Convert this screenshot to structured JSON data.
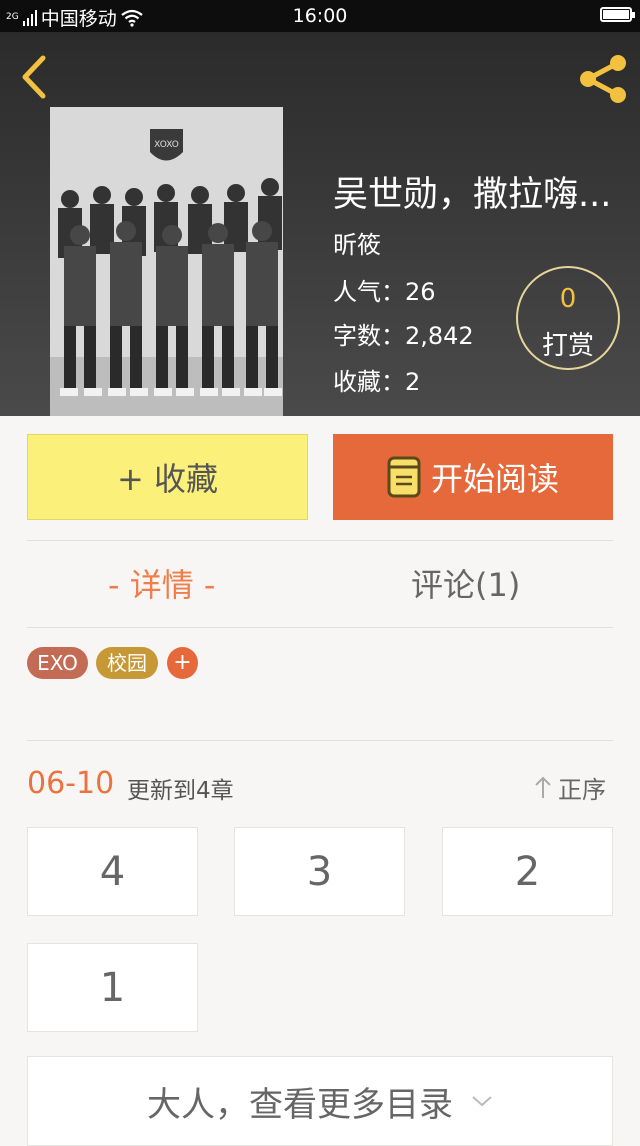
{
  "status_bar": {
    "signal_label": "2G",
    "carrier": "中国移动",
    "time": "16:00",
    "icons": [
      "signal-icon",
      "wifi-icon",
      "battery-icon"
    ]
  },
  "header": {
    "back_icon": "chevron-left-icon",
    "share_icon": "share-icon",
    "accent_color": "#f2c13f"
  },
  "book": {
    "title": "吴世勋，撒拉嗨...",
    "author": "昕筱",
    "popularity": "人气：26",
    "word_count": "字数：2,842",
    "favorites": "收藏：2",
    "reward_count": "0",
    "reward_label": "打赏",
    "cover_logo": "XOXO"
  },
  "actions": {
    "favorite_label": "+ 收藏",
    "read_label": "开始阅读",
    "read_icon": "book-icon"
  },
  "tabs": {
    "details": "- 详情 -",
    "comments": "评论(1)"
  },
  "tags": {
    "items": [
      "EXO",
      "校园"
    ],
    "add": "+"
  },
  "update": {
    "date": "06-10",
    "text": "更新到4章",
    "sort_label": "正序"
  },
  "chapters": [
    "4",
    "3",
    "2",
    "1"
  ],
  "more": {
    "label": "大人，查看更多目录"
  }
}
